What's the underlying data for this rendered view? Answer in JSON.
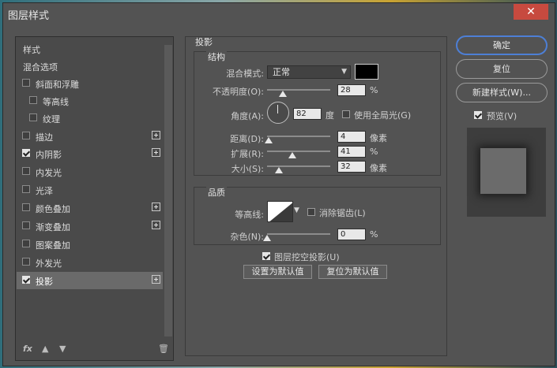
{
  "window": {
    "title": "图层样式",
    "close_icon": "close-icon"
  },
  "styles_list": {
    "items": [
      {
        "label": "样式"
      },
      {
        "label": "混合选项"
      },
      {
        "label": "斜面和浮雕",
        "checked": false
      },
      {
        "label": "等高线",
        "checked": false
      },
      {
        "label": "纹理",
        "checked": false
      },
      {
        "label": "描边",
        "checked": false
      },
      {
        "label": "内阴影",
        "checked": true
      },
      {
        "label": "内发光",
        "checked": false
      },
      {
        "label": "光泽",
        "checked": false
      },
      {
        "label": "颜色叠加",
        "checked": false
      },
      {
        "label": "渐变叠加",
        "checked": false
      },
      {
        "label": "图案叠加",
        "checked": false
      },
      {
        "label": "外发光",
        "checked": false
      },
      {
        "label": "投影",
        "checked": true,
        "selected": true
      }
    ],
    "fx_label": "fx"
  },
  "drop_shadow": {
    "section_title": "投影",
    "structure": {
      "title": "结构",
      "blend_mode_label": "混合模式:",
      "blend_mode_value": "正常",
      "color": "#000000",
      "opacity_label": "不透明度(O):",
      "opacity_value": "28",
      "opacity_unit": "%",
      "angle_label": "角度(A):",
      "angle_value": "82",
      "angle_unit": "度",
      "global_light_label": "使用全局光(G)",
      "global_light_checked": false,
      "distance_label": "距离(D):",
      "distance_value": "4",
      "distance_unit": "像素",
      "spread_label": "扩展(R):",
      "spread_value": "41",
      "spread_unit": "%",
      "size_label": "大小(S):",
      "size_value": "32",
      "size_unit": "像素"
    },
    "quality": {
      "title": "品质",
      "contour_label": "等高线:",
      "antialias_label": "消除锯齿(L)",
      "antialias_checked": false,
      "noise_label": "杂色(N):",
      "noise_value": "0",
      "noise_unit": "%"
    },
    "knockout_label": "图层挖空投影(U)",
    "knockout_checked": true,
    "set_default_label": "设置为默认值",
    "reset_default_label": "复位为默认值"
  },
  "actions": {
    "ok_label": "确定",
    "reset_label": "复位",
    "new_style_label": "新建样式(W)...",
    "preview_label": "预览(V)",
    "preview_checked": true
  },
  "colors": {
    "dialog_bg": "#535353",
    "accent": "#4d7fd6"
  }
}
